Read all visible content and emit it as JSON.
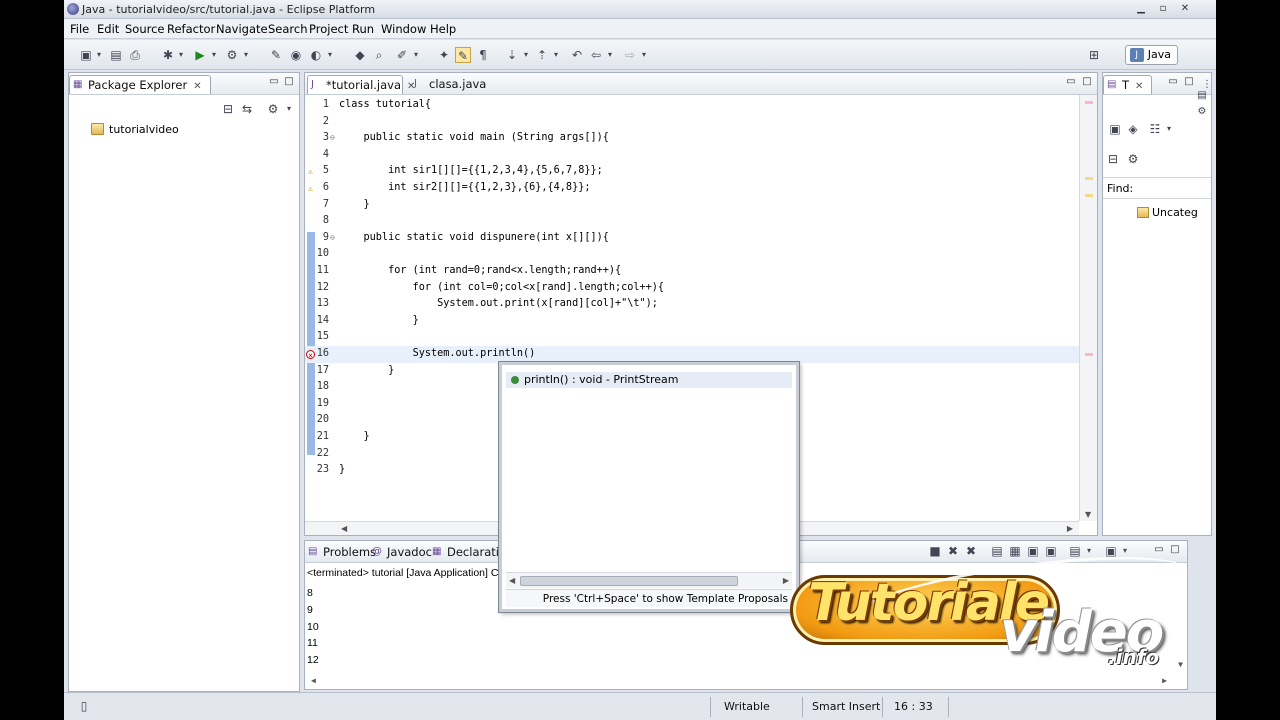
{
  "window": {
    "title": "Java - tutorialvideo/src/tutorial.java - Eclipse Platform"
  },
  "menu": [
    "File",
    "Edit",
    "Source",
    "Refactor",
    "Navigate",
    "Search",
    "Project",
    "Run",
    "Window",
    "Help"
  ],
  "perspective": {
    "label": "Java"
  },
  "package_explorer": {
    "tab": "Package Explorer",
    "project": "tutorialvideo"
  },
  "editor": {
    "tabs": [
      {
        "label": "*tutorial.java",
        "active": true
      },
      {
        "label": "clasa.java",
        "active": false
      }
    ],
    "lines": [
      {
        "n": "1",
        "text": "class tutorial{"
      },
      {
        "n": "2",
        "text": ""
      },
      {
        "n": "3",
        "text": "    public static void main (String args[]){"
      },
      {
        "n": "4",
        "text": ""
      },
      {
        "n": "5",
        "text": "        int sir1[][]={{1,2,3,4},{5,6,7,8}};"
      },
      {
        "n": "6",
        "text": "        int sir2[][]={{1,2,3},{6},{4,8}};"
      },
      {
        "n": "7",
        "text": "    }"
      },
      {
        "n": "8",
        "text": ""
      },
      {
        "n": "9",
        "text": "    public static void dispunere(int x[][]){"
      },
      {
        "n": "10",
        "text": ""
      },
      {
        "n": "11",
        "text": "        for (int rand=0;rand<x.length;rand++){"
      },
      {
        "n": "12",
        "text": "            for (int col=0;col<x[rand].length;col++){"
      },
      {
        "n": "13",
        "text": "                System.out.print(x[rand][col]+\"\\t\");"
      },
      {
        "n": "14",
        "text": "            }"
      },
      {
        "n": "15",
        "text": ""
      },
      {
        "n": "16",
        "text": "            System.out.println()"
      },
      {
        "n": "17",
        "text": "        }"
      },
      {
        "n": "18",
        "text": ""
      },
      {
        "n": "19",
        "text": ""
      },
      {
        "n": "20",
        "text": ""
      },
      {
        "n": "21",
        "text": "    }"
      },
      {
        "n": "22",
        "text": ""
      },
      {
        "n": "23",
        "text": "}"
      }
    ]
  },
  "outline": {
    "tab": "T",
    "find_label": "Find:",
    "category": "Uncateg"
  },
  "bottom_panel": {
    "tabs": [
      "Problems",
      "Javadoc",
      "Declaration"
    ],
    "console_header": "<terminated> tutorial [Java Application] C:",
    "console_lines": [
      "8",
      "9",
      "10",
      "11",
      "12"
    ]
  },
  "content_assist": {
    "proposal": "println() : void - PrintStream",
    "footer": "Press 'Ctrl+Space' to show Template Proposals"
  },
  "status": {
    "writable": "Writable",
    "insert_mode": "Smart Insert",
    "position": "16 : 33"
  },
  "watermark": {
    "line1": "Tutoriale",
    "line2": "video",
    "line3": ".info"
  }
}
